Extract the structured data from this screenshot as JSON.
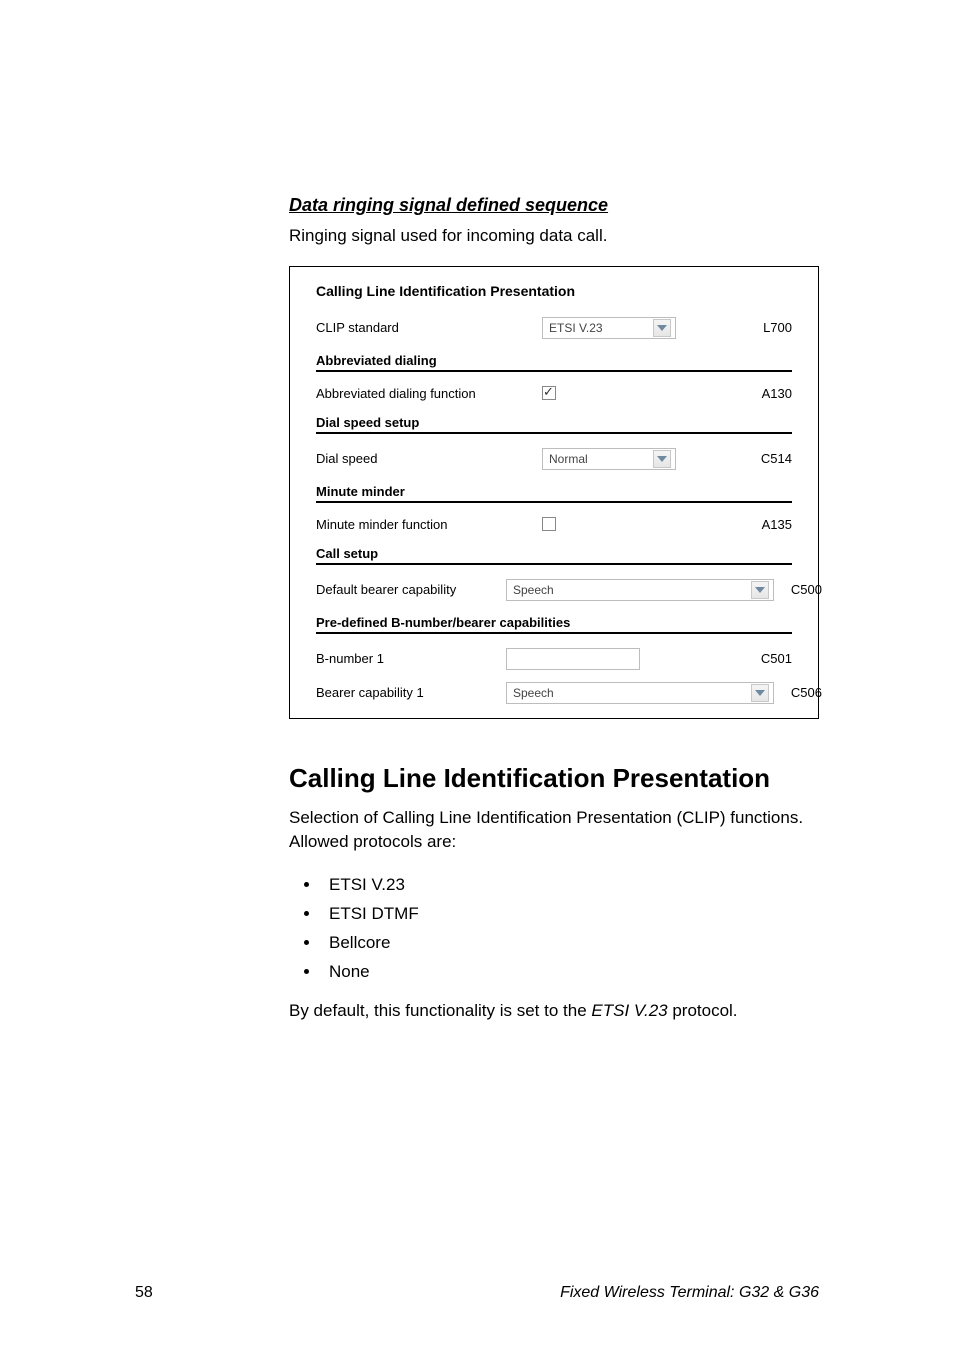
{
  "section": {
    "title": "Data ringing signal defined sequence",
    "desc": "Ringing signal used for incoming data call."
  },
  "figure": {
    "title": "Calling Line Identification Presentation",
    "clip": {
      "label": "CLIP standard",
      "value": "ETSI V.23",
      "code": "L700"
    },
    "abbrev_hdr": "Abbreviated dialing",
    "abbrev": {
      "label": "Abbreviated dialing function",
      "checked": true,
      "code": "A130"
    },
    "dialspeed_hdr": "Dial speed setup",
    "dialspeed": {
      "label": "Dial speed",
      "value": "Normal",
      "code": "C514"
    },
    "minute_hdr": "Minute minder",
    "minute": {
      "label": "Minute minder function",
      "checked": false,
      "code": "A135"
    },
    "callsetup_hdr": "Call setup",
    "callsetup": {
      "label": "Default bearer capability",
      "value": "Speech",
      "code": "C500"
    },
    "predef_hdr": "Pre-defined B-number/bearer capabilities",
    "bnum": {
      "label": "B-number 1",
      "code": "C501"
    },
    "bearer": {
      "label": "Bearer capability 1",
      "value": "Speech",
      "code": "C506"
    }
  },
  "body2": {
    "heading": "Calling Line Identification Presentation",
    "p1": "Selection of Calling Line Identification Presentation (CLIP) functions. Allowed protocols are:",
    "items": [
      "ETSI V.23",
      "ETSI DTMF",
      "Bellcore",
      "None"
    ],
    "p2_a": "By default, this functionality is set to the ",
    "p2_em": "ETSI V.23",
    "p2_b": " protocol."
  },
  "footer": {
    "page": "58",
    "doc": "Fixed Wireless Terminal: G32 & G36"
  }
}
